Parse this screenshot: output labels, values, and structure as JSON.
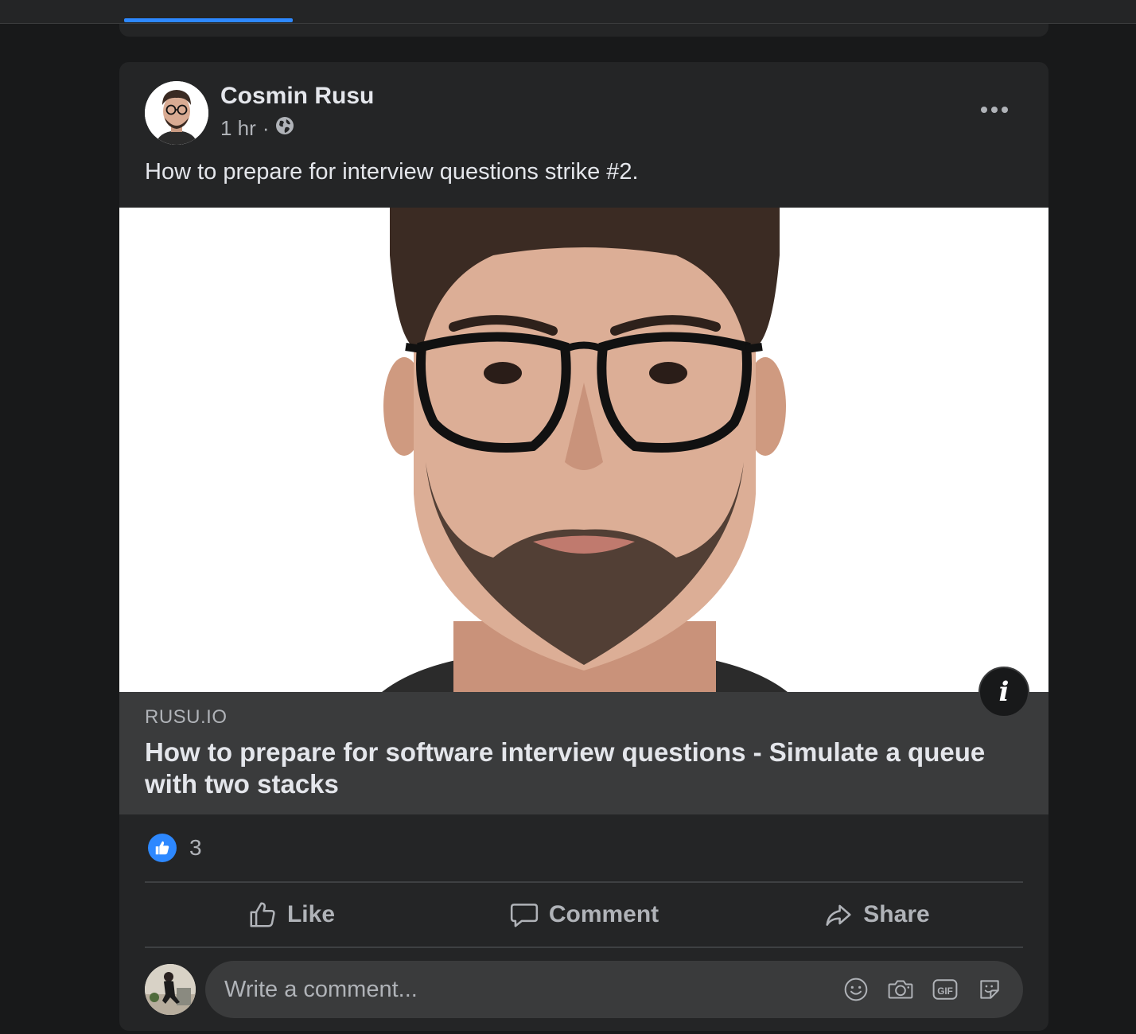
{
  "post": {
    "author": "Cosmin Rusu",
    "time": "1 hr",
    "separator": "·",
    "privacy_icon": "globe-icon",
    "text": "How to prepare for interview questions strike #2."
  },
  "link_preview": {
    "domain": "RUSU.IO",
    "title": "How to prepare for software interview questions - Simulate a queue with two stacks"
  },
  "reactions": {
    "icon": "like-icon",
    "count": "3"
  },
  "actions": {
    "like": "Like",
    "comment": "Comment",
    "share": "Share"
  },
  "composer": {
    "placeholder": "Write a comment...",
    "icons": [
      "emoji-icon",
      "camera-icon",
      "gif-icon",
      "sticker-icon"
    ],
    "gif_label": "GIF"
  },
  "colors": {
    "background": "#18191a",
    "card": "#242526",
    "accent": "#2d88ff",
    "secondary_text": "#b0b3b8"
  }
}
